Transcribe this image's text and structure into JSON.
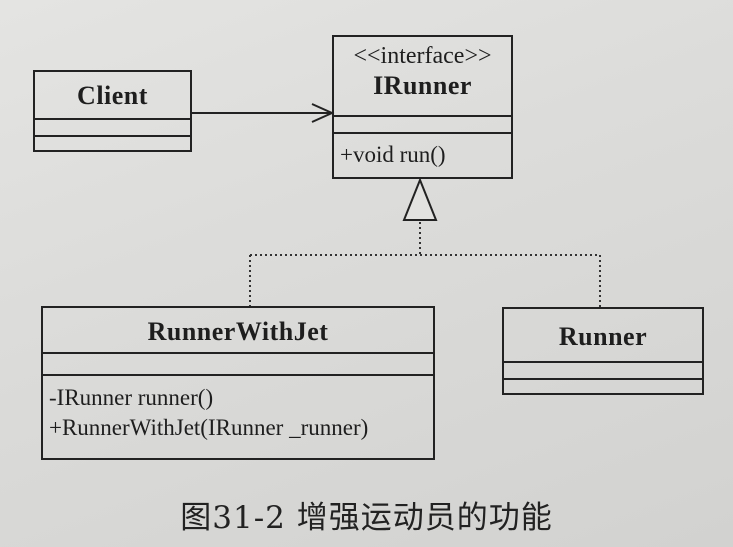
{
  "classes": {
    "client": {
      "name": "Client"
    },
    "irunner": {
      "stereotype": "<<interface>>",
      "name": "IRunner",
      "operations": [
        "+void run()"
      ]
    },
    "runner_with_jet": {
      "name": "RunnerWithJet",
      "members": [
        "-IRunner runner()",
        "+RunnerWithJet(IRunner _runner)"
      ]
    },
    "runner": {
      "name": "Runner"
    }
  },
  "caption": "图31-2   增强运动员的功能"
}
